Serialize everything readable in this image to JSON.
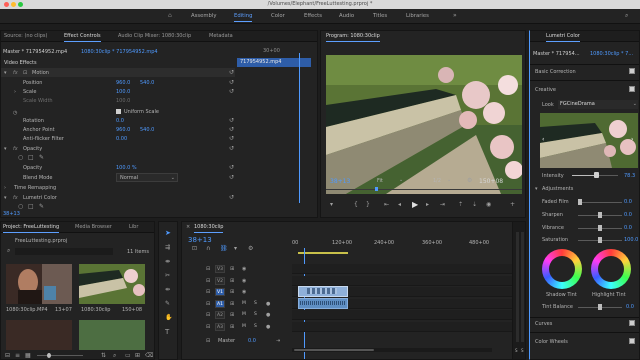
{
  "window": {
    "title": "/Volumes/Elephant/FreeLuttesting.prproj *"
  },
  "workspaces": [
    "Assembly",
    "Editing",
    "Color",
    "Effects",
    "Audio",
    "Titles",
    "Libraries"
  ],
  "source_panel": {
    "tabs": [
      "Source: (no clips)",
      "Effect Controls",
      "Audio Clip Mixer: 1080:30clip",
      "Metadata"
    ],
    "header_master": "Master * 717954952.mp4",
    "header_seq": "1080:30clip * 717954952.mp4",
    "timecode_mini": "30+00",
    "clip_name": "717954952.mp4",
    "section": "Video Effects",
    "motion": {
      "name": "Motion",
      "position_label": "Position",
      "position_x": "960.0",
      "position_y": "540.0",
      "scale_label": "Scale",
      "scale": "100.0",
      "scale_width_label": "Scale Width",
      "scale_width": "100.0",
      "uniform_label": "Uniform Scale",
      "rotation_label": "Rotation",
      "rotation": "0.0",
      "anchor_label": "Anchor Point",
      "anchor_x": "960.0",
      "anchor_y": "540.0",
      "flicker_label": "Anti-flicker Filter",
      "flicker": "0.00"
    },
    "opacity": {
      "name": "Opacity",
      "opacity_label": "Opacity",
      "opacity": "100.0 %",
      "blend_label": "Blend Mode",
      "blend": "Normal"
    },
    "time_remap": "Time Remapping",
    "lumetri": "Lumetri Color",
    "footer_tc": "38+13"
  },
  "program": {
    "tab": "Program: 1080:30clip",
    "timecode": "38+13",
    "fit": "Fit",
    "fraction": "1/2",
    "duration": "150+08"
  },
  "lumetri_panel": {
    "tab": "Lumetri Color",
    "master": "Master * 717954...",
    "seq": "1080:30clip * 7...",
    "basic": "Basic Correction",
    "creative": "Creative",
    "look_label": "Look",
    "look_value": "FGCineDrama",
    "intensity_label": "Intensity",
    "intensity_value": "78.3",
    "adjustments": "Adjustments",
    "rows": [
      {
        "label": "Faded Film",
        "value": "0.0",
        "frac": 0.0
      },
      {
        "label": "Sharpen",
        "value": "0.0",
        "frac": 0.5
      },
      {
        "label": "Vibrance",
        "value": "0.0",
        "frac": 0.5
      },
      {
        "label": "Saturation",
        "value": "100.0",
        "frac": 0.5
      }
    ],
    "shadow_tint": "Shadow Tint",
    "highlight_tint": "Highlight Tint",
    "tint_balance_label": "Tint Balance",
    "tint_balance_value": "0.0",
    "curves": "Curves",
    "color_wheels": "Color Wheels"
  },
  "project": {
    "tabs": [
      "Project: FreeLuttesting",
      "Media Browser",
      "Libr"
    ],
    "file": "FreeLuttesting.prproj",
    "count": "11 Items",
    "thumbs": [
      {
        "name": "1080:30clip.MP4",
        "dur": "13+07"
      },
      {
        "name": "1080:30clip",
        "dur": "150+08"
      }
    ]
  },
  "timeline": {
    "tab": "1080:30clip",
    "timecode": "38+13",
    "ruler": [
      "00",
      "120+00",
      "240+00",
      "360+00",
      "480+00"
    ],
    "video_tracks": [
      "V3",
      "V2",
      "V1"
    ],
    "audio_tracks": [
      "A1",
      "A2",
      "A3"
    ],
    "master_label": "Master",
    "master_value": "0.0",
    "meter_labels": [
      "S",
      "S"
    ]
  },
  "colors": {
    "accent": "#4f9aff",
    "selection": "#2e5da8",
    "clip_video": "#8fb0d9",
    "clip_audio": "#5f8fc4"
  }
}
